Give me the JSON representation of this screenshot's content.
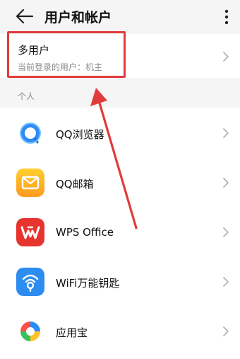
{
  "header": {
    "title": "用户和帐户",
    "back_icon": "arrow-left-icon",
    "more_icon": "more-vertical-icon"
  },
  "multi_user": {
    "title": "多用户",
    "subtitle": "当前登录的用户：机主"
  },
  "section": {
    "label": "个人"
  },
  "accounts": [
    {
      "label": "QQ浏览器",
      "icon": "qq-browser-icon"
    },
    {
      "label": "QQ邮箱",
      "icon": "qq-mail-icon"
    },
    {
      "label": "WPS Office",
      "icon": "wps-office-icon"
    },
    {
      "label": "WiFi万能钥匙",
      "icon": "wifi-master-key-icon"
    },
    {
      "label": "应用宝",
      "icon": "app-treasure-icon"
    }
  ],
  "annotation_color": "#e23b3b"
}
